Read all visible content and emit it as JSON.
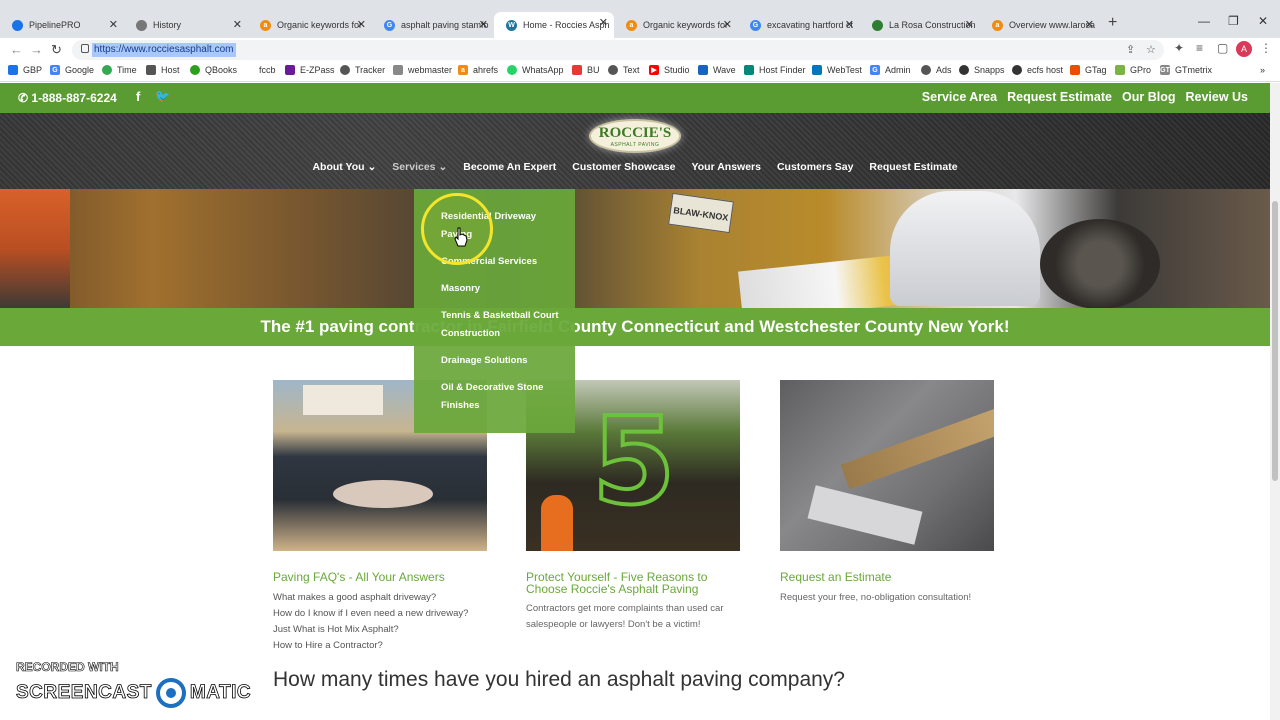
{
  "browser": {
    "tabs": [
      {
        "title": "PipelinePRO",
        "icon": "pipeline-icon",
        "color": "#1a73e8",
        "active": false
      },
      {
        "title": "History",
        "icon": "history-icon",
        "color": "#777777",
        "active": false
      },
      {
        "title": "Organic keywords for",
        "icon": "ahrefs-icon",
        "color": "#f28b13",
        "active": false
      },
      {
        "title": "asphalt paving stamfo",
        "icon": "google-icon",
        "color": "#4285f4",
        "active": false
      },
      {
        "title": "Home - Roccies Asph",
        "icon": "wordpress-icon",
        "color": "#21759b",
        "active": true
      },
      {
        "title": "Organic keywords for",
        "icon": "ahrefs-icon",
        "color": "#f28b13",
        "active": false
      },
      {
        "title": "excavating hartford ct",
        "icon": "google-icon",
        "color": "#4285f4",
        "active": false
      },
      {
        "title": "La Rosa Construction",
        "icon": "larosa-icon",
        "color": "#2e7d32",
        "active": false
      },
      {
        "title": "Overview www.larosa",
        "icon": "ahrefs-icon",
        "color": "#f28b13",
        "active": false
      }
    ],
    "url": "https://www.rocciesasphalt.com",
    "avatar_letter": "A",
    "bookmarks": [
      {
        "label": "GBP",
        "icon": "gbp-icon",
        "color": "#1a73e8"
      },
      {
        "label": "Google",
        "icon": "google-icon",
        "color": "#4285f4"
      },
      {
        "label": "Time",
        "icon": "clock-icon",
        "color": "#34a853"
      },
      {
        "label": "Host",
        "icon": "host-icon",
        "color": "#555555"
      },
      {
        "label": "QBooks",
        "icon": "quickbooks-icon",
        "color": "#2ca01c"
      },
      {
        "label": "fccb",
        "icon": "",
        "color": ""
      },
      {
        "label": "E-ZPass",
        "icon": "ezpass-icon",
        "color": "#6a1b9a"
      },
      {
        "label": "Tracker",
        "icon": "tracker-icon",
        "color": "#555555"
      },
      {
        "label": "webmaster",
        "icon": "webmaster-icon",
        "color": "#888888"
      },
      {
        "label": "ahrefs",
        "icon": "ahrefs-icon",
        "color": "#f28b13"
      },
      {
        "label": "WhatsApp",
        "icon": "whatsapp-icon",
        "color": "#25d366"
      },
      {
        "label": "BU",
        "icon": "bu-icon",
        "color": "#e53935"
      },
      {
        "label": "Text",
        "icon": "text-icon",
        "color": "#555555"
      },
      {
        "label": "Studio",
        "icon": "youtube-icon",
        "color": "#ff0000"
      },
      {
        "label": "Wave",
        "icon": "wave-icon",
        "color": "#1565c0"
      },
      {
        "label": "Host Finder",
        "icon": "host-finder-icon",
        "color": "#00897b"
      },
      {
        "label": "WebTest",
        "icon": "webtest-icon",
        "color": "#0277bd"
      },
      {
        "label": "Admin",
        "icon": "google-icon",
        "color": "#4285f4"
      },
      {
        "label": "Ads",
        "icon": "ads-icon",
        "color": "#555555"
      },
      {
        "label": "Snapps",
        "icon": "snapps-icon",
        "color": "#333333"
      },
      {
        "label": "ecfs host",
        "icon": "ecfs-icon",
        "color": "#333333"
      },
      {
        "label": "GTag",
        "icon": "gtag-icon",
        "color": "#e65100"
      },
      {
        "label": "GPro",
        "icon": "gpro-icon",
        "color": "#7cb342"
      },
      {
        "label": "GTmetrix",
        "icon": "gtmetrix-icon",
        "color": "#888888"
      }
    ]
  },
  "site": {
    "phone": "1-888-887-6224",
    "top_links": [
      "Service Area",
      "Request Estimate",
      "Our Blog",
      "Review Us"
    ],
    "logo_line1": "ROCCIE'S",
    "logo_line2": "ASPHALT PAVING",
    "nav": [
      {
        "label": "About You",
        "dropdown": true
      },
      {
        "label": "Services",
        "dropdown": true
      },
      {
        "label": "Become An Expert",
        "dropdown": false
      },
      {
        "label": "Customer Showcase",
        "dropdown": false
      },
      {
        "label": "Your Answers",
        "dropdown": false
      },
      {
        "label": "Customers Say",
        "dropdown": false
      },
      {
        "label": "Request Estimate",
        "dropdown": false
      }
    ],
    "services_menu": [
      "Residential Driveway Paving",
      "Commercial Services",
      "Masonry",
      "Tennis & Basketball Court Construction",
      "Drainage Solutions",
      "Oil & Decorative Stone Finishes"
    ],
    "hero_sign": "BLAW-KNOX",
    "tagline": "The #1 paving contractor in Fairfield County Connecticut and Westchester County New York!",
    "cards": [
      {
        "title": "Paving FAQ's - All Your Answers",
        "links": [
          "What makes a good asphalt driveway?",
          "How do I know if I even need a new driveway?",
          "Just What is Hot Mix Asphalt?",
          "How to Hire a Contractor?"
        ]
      },
      {
        "title": "Protect Yourself - Five Reasons to Choose Roccie's Asphalt Paving",
        "image_numeral": "5",
        "text": "Contractors get more complaints than used car salespeople or lawyers! Don't be a victim!"
      },
      {
        "title": "Request an Estimate",
        "text": "Request your free, no-obligation consultation!"
      }
    ],
    "question": "How many times have you hired an asphalt paving company?",
    "colors": {
      "brand_green": "#5a9b32",
      "menu_green": "#6aa83a",
      "link_green": "#6aa83a"
    }
  },
  "watermark": {
    "line1": "RECORDED WITH",
    "left": "SCREENCAST",
    "right": "MATIC"
  }
}
